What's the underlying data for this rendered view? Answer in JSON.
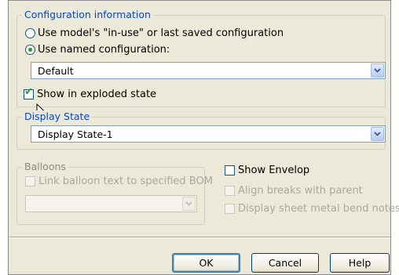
{
  "configuration": {
    "title": "Configuration information",
    "option_in_use": "Use model's \"in-use\" or last saved configuration",
    "option_named": "Use named configuration:",
    "named_value": "Default",
    "show_exploded": "Show in exploded state",
    "selected_option": "named",
    "exploded_checked": true
  },
  "display_state": {
    "title": "Display State",
    "value": "Display State-1"
  },
  "balloons": {
    "title": "Balloons",
    "link_label": "Link balloon text to specified BOM",
    "combo_value": ""
  },
  "options": {
    "show_envelop": "Show Envelop",
    "align_breaks": "Align breaks with parent",
    "display_bend_notes": "Display sheet metal bend notes"
  },
  "buttons": {
    "ok": "OK",
    "cancel": "Cancel",
    "help": "Help"
  },
  "icons": {
    "dropdown": "chevron-down-icon",
    "cursor": "mouse-pointer-icon"
  },
  "colors": {
    "group_title": "#0046d5",
    "radio_dot": "#21a121",
    "dialog_bg": "#ece9d8"
  }
}
